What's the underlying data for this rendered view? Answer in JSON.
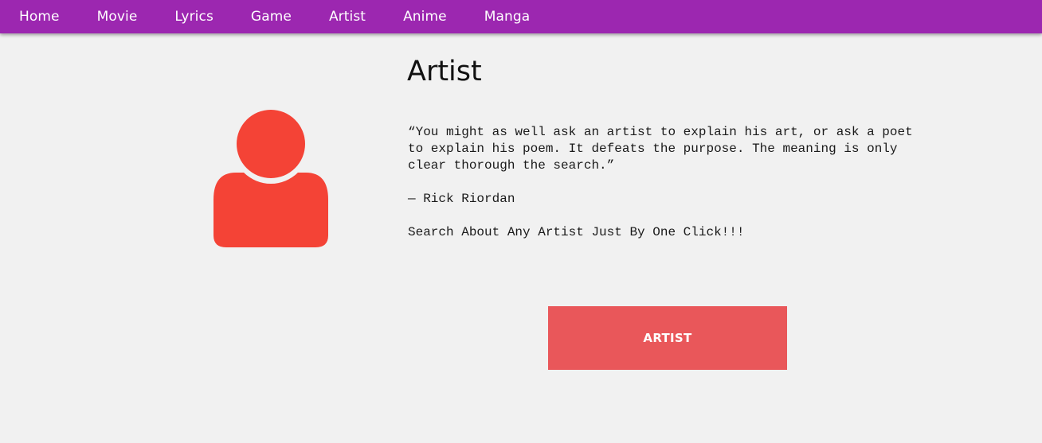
{
  "nav": {
    "items": [
      {
        "label": "Home"
      },
      {
        "label": "Movie"
      },
      {
        "label": "Lyrics"
      },
      {
        "label": "Game"
      },
      {
        "label": "Artist"
      },
      {
        "label": "Anime"
      },
      {
        "label": "Manga"
      }
    ]
  },
  "main": {
    "title": "Artist",
    "avatar_icon": "user-icon",
    "quote": "“You might as well ask an artist to explain his art, or ask a poet to explain his poem. It defeats the purpose. The meaning is only clear thorough the search.”",
    "attribution": "— Rick Riordan",
    "tagline": "Search About Any Artist Just By One Click!!!",
    "button_label": "ARTIST"
  },
  "colors": {
    "nav_background": "#9c27b0",
    "page_background": "#f1f1f1",
    "avatar": "#f44336",
    "button": "#e9575a"
  }
}
